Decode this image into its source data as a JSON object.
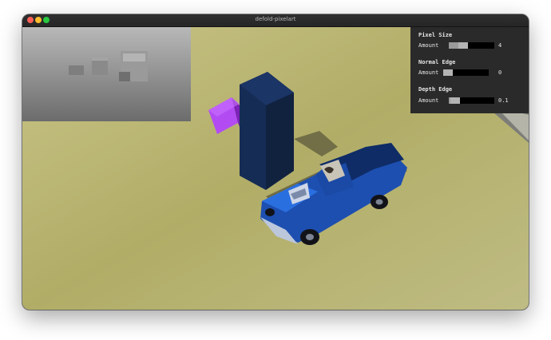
{
  "window": {
    "title": "defold-pixelart",
    "traffic_lights": {
      "close": "#fe5f57",
      "minimize": "#febc2e",
      "zoom": "#28c840"
    }
  },
  "scene": {
    "depth_preview": "grayscale depth buffer preview",
    "ground_color": "#b6b06e",
    "purple_cube_color": "#9a38e6",
    "pillar_color": "#132a52",
    "truck_color": "#1f5fc8"
  },
  "gui": {
    "sections": [
      {
        "title": "Pixel Size",
        "label": "Amount",
        "value": "4",
        "level": 0.3
      },
      {
        "title": "Normal Edge",
        "label": "Amount",
        "value": "0",
        "level": 0.0
      },
      {
        "title": "Depth Edge",
        "label": "Amount",
        "value": "0.1",
        "level": 0.05
      }
    ]
  }
}
